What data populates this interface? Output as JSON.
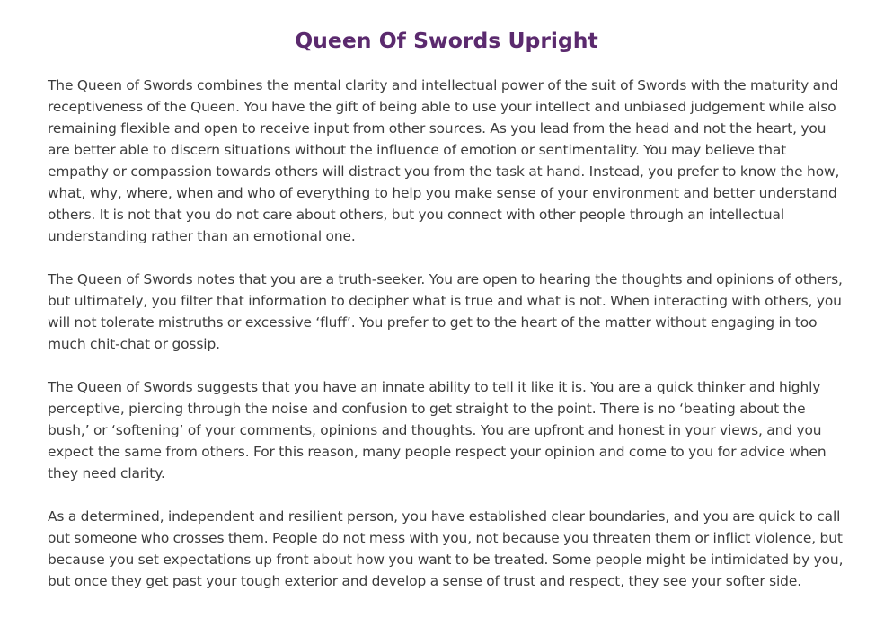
{
  "page": {
    "title": "Queen Of Swords Upright",
    "colors": {
      "title": "#5b2a6e",
      "body_text": "#3d3d3d",
      "background": "#ffffff"
    },
    "paragraphs": [
      "The Queen of Swords combines the mental clarity and intellectual power of the suit of Swords with the maturity and receptiveness of the Queen. You have the gift of being able to use your intellect and unbiased judgement while also remaining flexible and open to receive input from other sources. As you lead from the head and not the heart, you are better able to discern situations without the influence of emotion or sentimentality. You may believe that empathy or compassion towards others will distract you from the task at hand. Instead, you prefer to know the how, what, why, where, when and who of everything to help you make sense of your environment and better understand others. It is not that you do not care about others, but you connect with other people through an intellectual understanding rather than an emotional one.",
      "The Queen of Swords notes that you are a truth-seeker. You are open to hearing the thoughts and opinions of others, but ultimately, you filter that information to decipher what is true and what is not. When interacting with others, you will not tolerate mistruths or excessive ‘fluff’. You prefer to get to the heart of the matter without engaging in too much chit-chat or gossip.",
      "The Queen of Swords suggests that you have an innate ability to tell it like it is. You are a quick thinker and highly perceptive, piercing through the noise and confusion to get straight to the point. There is no ‘beating about the bush,’ or ‘softening’ of your comments, opinions and thoughts. You are upfront and honest in your views, and you expect the same from others. For this reason, many people respect your opinion and come to you for advice when they need clarity.",
      "As a determined, independent and resilient person, you have established clear boundaries, and you are quick to call out someone who crosses them. People do not mess with you, not because you threaten them or inflict violence, but because you set expectations up front about how you want to be treated. Some people might be intimidated by you, but once they get past your tough exterior and develop a sense of trust and respect, they see your softer side."
    ]
  }
}
